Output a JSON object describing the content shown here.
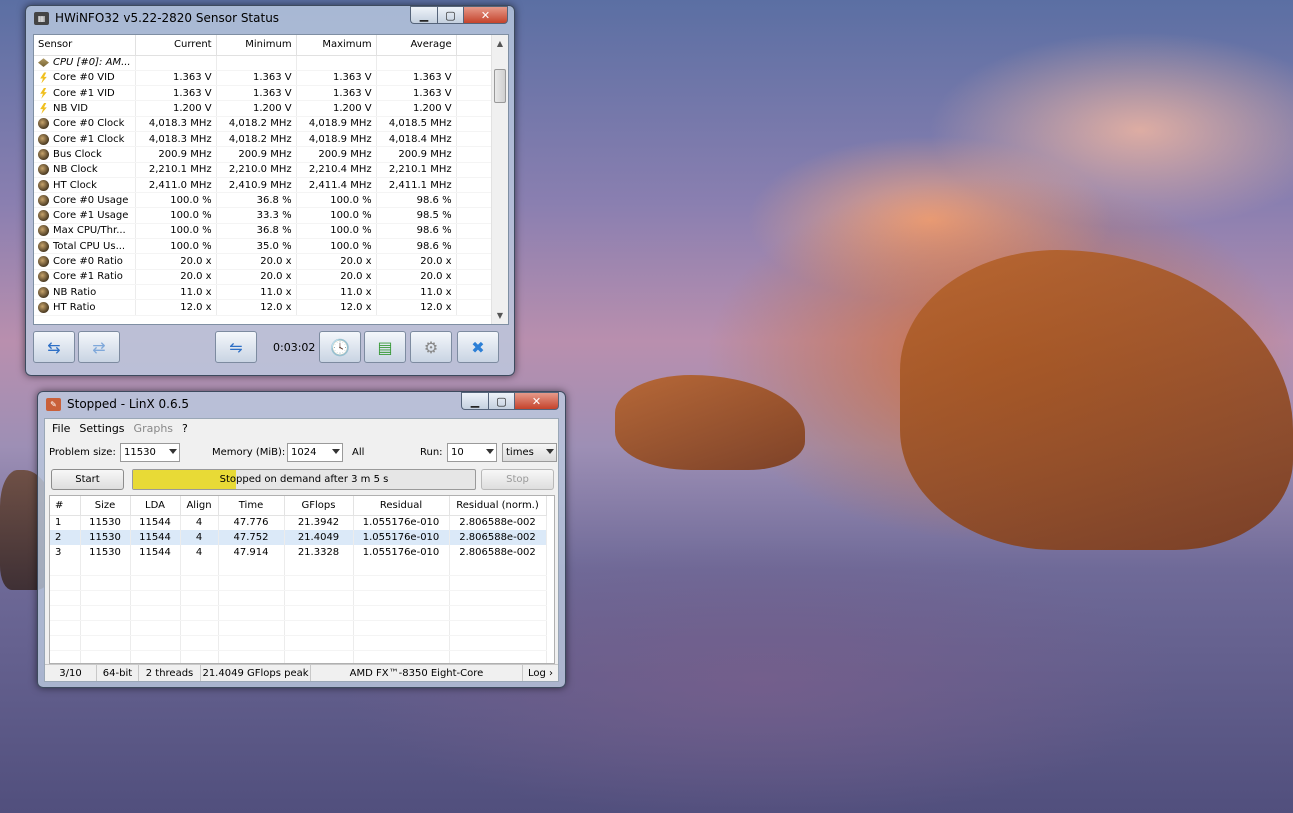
{
  "hwinfo": {
    "title": "HWiNFO32 v5.22-2820 Sensor Status",
    "icon": "hwinfo-app-icon",
    "columns": [
      "Sensor",
      "Current",
      "Minimum",
      "Maximum",
      "Average"
    ],
    "group": "CPU [#0]: AM...",
    "rows": [
      {
        "icon": "voltage-icon",
        "name": "Core #0 VID",
        "current": "1.363 V",
        "minimum": "1.363 V",
        "maximum": "1.363 V",
        "average": "1.363 V"
      },
      {
        "icon": "voltage-icon",
        "name": "Core #1 VID",
        "current": "1.363 V",
        "minimum": "1.363 V",
        "maximum": "1.363 V",
        "average": "1.363 V"
      },
      {
        "icon": "voltage-icon",
        "name": "NB VID",
        "current": "1.200 V",
        "minimum": "1.200 V",
        "maximum": "1.200 V",
        "average": "1.200 V"
      },
      {
        "icon": "clock-icon",
        "name": "Core #0 Clock",
        "current": "4,018.3 MHz",
        "minimum": "4,018.2 MHz",
        "maximum": "4,018.9 MHz",
        "average": "4,018.5 MHz"
      },
      {
        "icon": "clock-icon",
        "name": "Core #1 Clock",
        "current": "4,018.3 MHz",
        "minimum": "4,018.2 MHz",
        "maximum": "4,018.9 MHz",
        "average": "4,018.4 MHz"
      },
      {
        "icon": "clock-icon",
        "name": "Bus Clock",
        "current": "200.9 MHz",
        "minimum": "200.9 MHz",
        "maximum": "200.9 MHz",
        "average": "200.9 MHz"
      },
      {
        "icon": "clock-icon",
        "name": "NB Clock",
        "current": "2,210.1 MHz",
        "minimum": "2,210.0 MHz",
        "maximum": "2,210.4 MHz",
        "average": "2,210.1 MHz"
      },
      {
        "icon": "clock-icon",
        "name": "HT Clock",
        "current": "2,411.0 MHz",
        "minimum": "2,410.9 MHz",
        "maximum": "2,411.4 MHz",
        "average": "2,411.1 MHz"
      },
      {
        "icon": "clock-icon",
        "name": "Core #0 Usage",
        "current": "100.0 %",
        "minimum": "36.8 %",
        "maximum": "100.0 %",
        "average": "98.6 %"
      },
      {
        "icon": "clock-icon",
        "name": "Core #1 Usage",
        "current": "100.0 %",
        "minimum": "33.3 %",
        "maximum": "100.0 %",
        "average": "98.5 %"
      },
      {
        "icon": "clock-icon",
        "name": "Max CPU/Thr...",
        "current": "100.0 %",
        "minimum": "36.8 %",
        "maximum": "100.0 %",
        "average": "98.6 %"
      },
      {
        "icon": "clock-icon",
        "name": "Total CPU Us...",
        "current": "100.0 %",
        "minimum": "35.0 %",
        "maximum": "100.0 %",
        "average": "98.6 %"
      },
      {
        "icon": "clock-icon",
        "name": "Core #0 Ratio",
        "current": "20.0 x",
        "minimum": "20.0 x",
        "maximum": "20.0 x",
        "average": "20.0 x"
      },
      {
        "icon": "clock-icon",
        "name": "Core #1 Ratio",
        "current": "20.0 x",
        "minimum": "20.0 x",
        "maximum": "20.0 x",
        "average": "20.0 x"
      },
      {
        "icon": "clock-icon",
        "name": "NB Ratio",
        "current": "11.0 x",
        "minimum": "11.0 x",
        "maximum": "11.0 x",
        "average": "11.0 x"
      },
      {
        "icon": "clock-icon",
        "name": "HT Ratio",
        "current": "12.0 x",
        "minimum": "12.0 x",
        "maximum": "12.0 x",
        "average": "12.0 x"
      }
    ],
    "toolbar": {
      "timer": "0:03:02",
      "buttons": [
        "expand-arrows-icon",
        "collapse-arrows-icon",
        "network-icon",
        "clock-icon",
        "report-icon",
        "settings-gear-icon",
        "close-x-icon"
      ]
    }
  },
  "linx": {
    "title": "Stopped - LinX 0.6.5",
    "menu": [
      "File",
      "Settings",
      "Graphs",
      "?"
    ],
    "problem_size_label": "Problem size:",
    "problem_size": "11530",
    "memory_label": "Memory (MiB):",
    "memory": "1024",
    "all_label": "All",
    "run_label": "Run:",
    "run": "10",
    "run_unit": "times",
    "start_label": "Start",
    "stop_label": "Stop",
    "progress_text": "Stopped on demand after 3 m 5 s",
    "progress_fraction": 0.3,
    "progress_color": "#e8da36",
    "columns": [
      "#",
      "Size",
      "LDA",
      "Align",
      "Time",
      "GFlops",
      "Residual",
      "Residual (norm.)"
    ],
    "results": [
      [
        "1",
        "11530",
        "11544",
        "4",
        "47.776",
        "21.3942",
        "1.055176e-010",
        "2.806588e-002"
      ],
      [
        "2",
        "11530",
        "11544",
        "4",
        "47.752",
        "21.4049",
        "1.055176e-010",
        "2.806588e-002"
      ],
      [
        "3",
        "11530",
        "11544",
        "4",
        "47.914",
        "21.3328",
        "1.055176e-010",
        "2.806588e-002"
      ]
    ],
    "selected_row": 1,
    "status": {
      "progress": "3/10",
      "bits": "64-bit",
      "threads": "2 threads",
      "peak": "21.4049 GFlops peak",
      "cpu": "AMD FX™-8350 Eight-Core",
      "log": "Log ›"
    }
  }
}
